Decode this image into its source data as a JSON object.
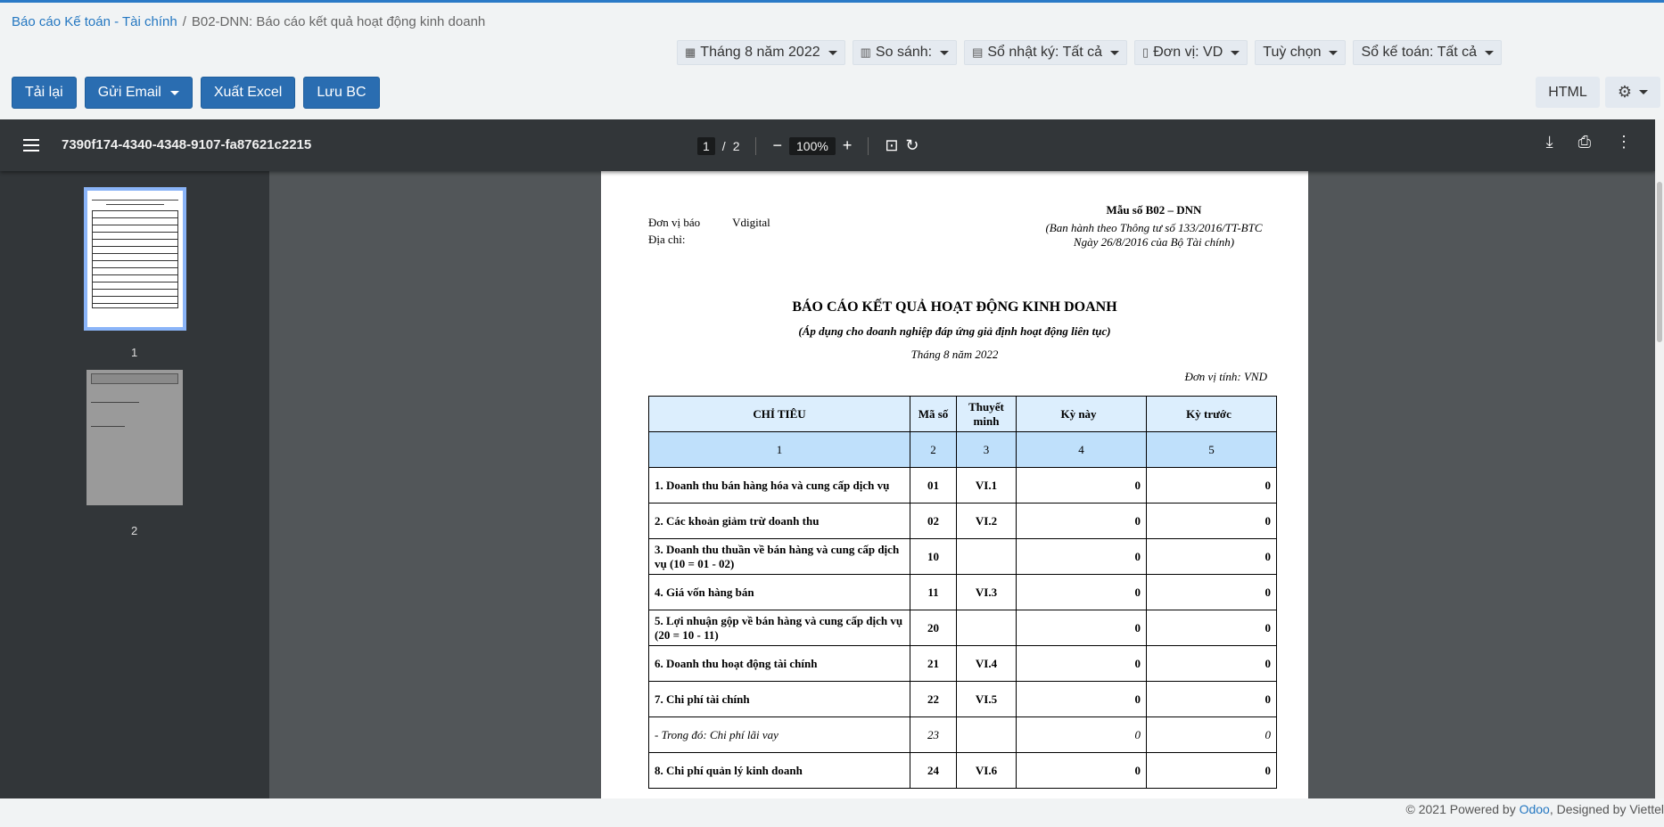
{
  "breadcrumb": {
    "root": "Báo cáo Kế toán - Tài chính",
    "separator": "/",
    "current": "B02-DNN: Báo cáo kết quả hoạt động kinh doanh"
  },
  "filters": [
    {
      "icon": "calendar-icon",
      "label": "Tháng 8 năm 2022"
    },
    {
      "icon": "bar-chart-icon",
      "label": "So sánh:"
    },
    {
      "icon": "book-icon",
      "label": "Sổ nhật ký: Tất cả"
    },
    {
      "icon": "building-icon",
      "label": "Đơn vị: VD"
    },
    {
      "icon": "",
      "label": "Tuỳ chọn"
    },
    {
      "icon": "",
      "label": "Sổ kế toán: Tất cả"
    }
  ],
  "toolbar": {
    "reload": "Tải lại",
    "send_email": "Gửi Email",
    "export_excel": "Xuất Excel",
    "save": "Lưu BC",
    "html": "HTML"
  },
  "viewer": {
    "doc_name": "7390f174-4340-4348-9107-fa87621c2215",
    "page_current": "1",
    "page_sep": "/",
    "page_total": "2",
    "zoom": "100%",
    "thumbs": [
      "1",
      "2"
    ]
  },
  "report": {
    "unit_label": "Đơn vị báo",
    "unit_value": "Vdigital",
    "address_label": "Địa chỉ:",
    "form": "Mẫu số B02 – DNN",
    "circular1": "(Ban hành theo Thông tư số 133/2016/TT-BTC",
    "circular2": "Ngày 26/8/2016 của Bộ Tài chính)",
    "title": "BÁO CÁO KẾT QUẢ HOẠT ĐỘNG KINH DOANH",
    "subtitle": "(Áp dụng cho doanh nghiệp đáp ứng giả định hoạt động liên tục)",
    "period": "Tháng 8 năm 2022",
    "currency": "Đơn vị tính: VND",
    "headers": [
      "CHỈ TIÊU",
      "Mã số",
      "Thuyết minh",
      "Kỳ này",
      "Kỳ trước"
    ],
    "index_row": [
      "1",
      "2",
      "3",
      "4",
      "5"
    ],
    "rows": [
      {
        "name": "1. Doanh thu bán hàng hóa và cung cấp dịch vụ",
        "code": "01",
        "note": "VI.1",
        "cur": "0",
        "prev": "0"
      },
      {
        "name": "2. Các khoản giảm trừ doanh thu",
        "code": "02",
        "note": "VI.2",
        "cur": "0",
        "prev": "0"
      },
      {
        "name": "3. Doanh thu thuần về bán hàng và cung cấp dịch vụ (10 = 01 - 02)",
        "code": "10",
        "note": "",
        "cur": "0",
        "prev": "0"
      },
      {
        "name": "4. Giá vốn hàng bán",
        "code": "11",
        "note": "VI.3",
        "cur": "0",
        "prev": "0"
      },
      {
        "name": "5. Lợi nhuận gộp về bán hàng và cung cấp dịch vụ (20 = 10 - 11)",
        "code": "20",
        "note": "",
        "cur": "0",
        "prev": "0"
      },
      {
        "name": "6. Doanh thu hoạt động tài chính",
        "code": "21",
        "note": "VI.4",
        "cur": "0",
        "prev": "0"
      },
      {
        "name": "7. Chi phí tài chính",
        "code": "22",
        "note": "VI.5",
        "cur": "0",
        "prev": "0"
      },
      {
        "name": "- Trong đó: Chi phí lãi vay",
        "code": "23",
        "note": "",
        "cur": "0",
        "prev": "0"
      },
      {
        "name": "8. Chi phí quản lý kinh doanh",
        "code": "24",
        "note": "VI.6",
        "cur": "0",
        "prev": "0"
      }
    ]
  },
  "footer": {
    "prefix": "© 2021 Powered by ",
    "odoo": "Odoo",
    "suffix": ", Designed by Viettel"
  }
}
